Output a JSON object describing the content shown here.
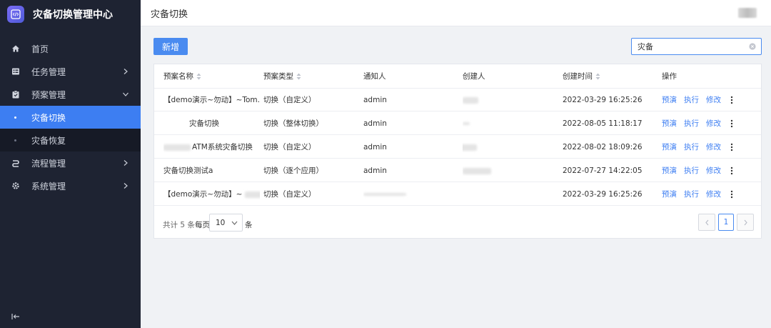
{
  "app": {
    "title": "灾备切换管理中心",
    "logo_icon": "code-icon"
  },
  "sidebar": {
    "items": [
      {
        "label": "首页",
        "icon": "home-icon"
      },
      {
        "label": "任务管理",
        "icon": "task-icon"
      },
      {
        "label": "预案管理",
        "icon": "clipboard-icon"
      },
      {
        "label": "灾备切换",
        "sub": true,
        "active": true
      },
      {
        "label": "灾备恢复",
        "sub": true
      },
      {
        "label": "流程管理",
        "icon": "flow-icon"
      },
      {
        "label": "系统管理",
        "icon": "gear-icon"
      }
    ]
  },
  "header": {
    "title": "灾备切换"
  },
  "toolbar": {
    "add_label": "新增",
    "search_value": "灾备"
  },
  "table": {
    "columns": [
      "预案名称",
      "预案类型",
      "通知人",
      "创建人",
      "创建时间",
      "操作"
    ],
    "actions": [
      "预演",
      "执行",
      "修改"
    ],
    "rows": [
      {
        "name": "【demo演示~勿动】~Tom...",
        "type": "切换（自定义）",
        "notify": "admin",
        "time": "2022-03-29 16:25:26"
      },
      {
        "name": "灾备切换",
        "type": "切换（整体切换）",
        "notify": "admin",
        "time": "2022-08-05 11:18:17"
      },
      {
        "name": "ATM系统灾备切换",
        "type": "切换（自定义）",
        "notify": "admin",
        "time": "2022-08-02 18:09:26"
      },
      {
        "name": "灾备切换测试a",
        "type": "切换（逐个应用）",
        "notify": "admin",
        "time": "2022-07-27 14:22:05"
      },
      {
        "name": "【demo演示~勿动】~",
        "type": "切换（自定义）",
        "notify": "",
        "time": "2022-03-29 16:25:26"
      }
    ]
  },
  "pagination": {
    "total_label": "共计 5 条",
    "per_page_label": "每页",
    "page_size": "10",
    "unit_label": "条",
    "current_page": "1"
  },
  "colors": {
    "accent": "#3d7ef2",
    "sidebar_bg": "#1e2332"
  }
}
